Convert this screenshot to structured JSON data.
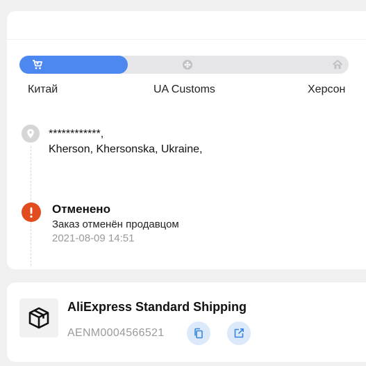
{
  "progress": {
    "filled_stages": 1,
    "total_stages": 3,
    "fill_fraction": 0.33,
    "active_color": "#4d88f0",
    "inactive_color": "#e6e6e9",
    "stages": [
      {
        "label": "Китай",
        "icon": "shopping-cart-icon"
      },
      {
        "label": "UA Customs",
        "icon": "customs-icon"
      },
      {
        "label": "Херсон",
        "icon": "house-icon"
      }
    ]
  },
  "address": {
    "icon": "location-pin-icon",
    "line1": "                          ************,",
    "line2": "   Kherson, Khersonska, Ukraine,"
  },
  "event": {
    "icon": "alert-icon",
    "status_color": "#e24b1e",
    "title": "Отменено",
    "description": "Заказ отменён продавцом",
    "time": "2021-08-09 14:51"
  },
  "shipping": {
    "icon": "package-box-icon",
    "carrier": "AliExpress Standard Shipping",
    "tracking_number": "AENM0004566521",
    "copy_icon": "copy-icon",
    "open_icon": "external-link-icon"
  }
}
